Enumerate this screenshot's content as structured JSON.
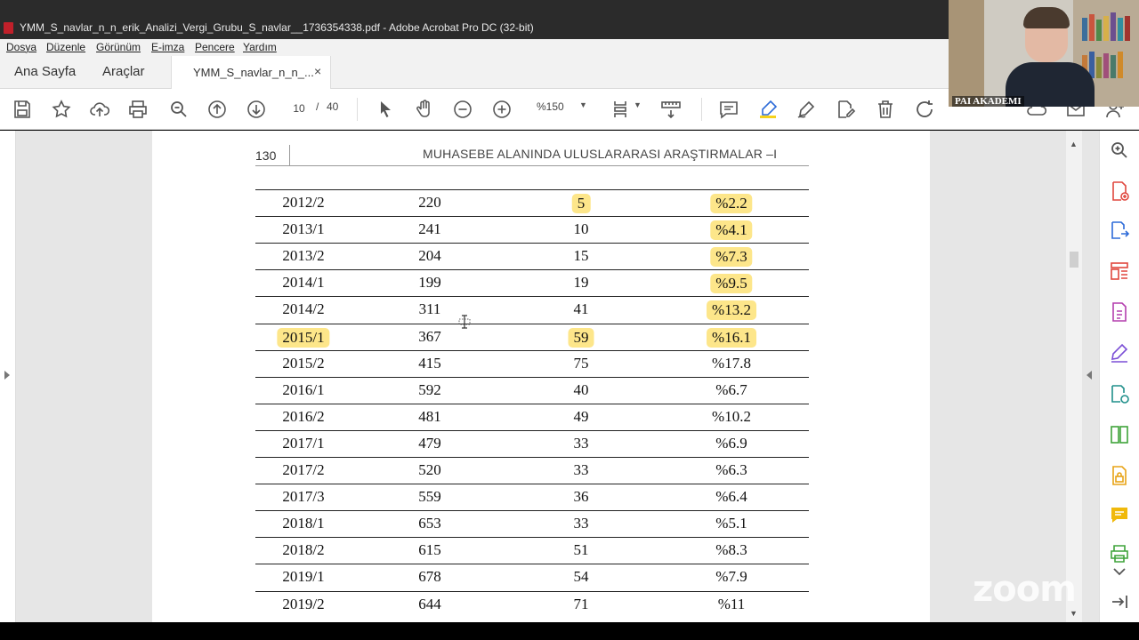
{
  "window": {
    "title": "YMM_S_navlar_n_n_erik_Analizi_Vergi_Grubu_S_navlar__1736354338.pdf - Adobe Acrobat Pro DC (32-bit)"
  },
  "menu": [
    "Dosya",
    "Düzenle",
    "Görünüm",
    "E-imza",
    "Pencere",
    "Yardım"
  ],
  "tabs": {
    "home": "Ana Sayfa",
    "tools": "Araçlar",
    "document": "YMM_S_navlar_n_n_...",
    "close": "×"
  },
  "toolbar": {
    "current_page": "10",
    "separator": "/",
    "total_pages": "40",
    "zoom": "%150",
    "icons": [
      "save-icon",
      "star-icon",
      "upload-icon",
      "print-icon",
      "search-icon",
      "page-up-icon",
      "page-down-icon",
      "select-cursor-icon",
      "hand-icon",
      "zoom-out-icon",
      "zoom-in-icon",
      "page-layout-icon",
      "measure-icon",
      "comment-icon",
      "highlight-icon",
      "draw-icon",
      "edit-icon",
      "delete-icon",
      "rotate-icon"
    ]
  },
  "page": {
    "number": "130",
    "running_head": "MUHASEBE ALANINDA ULUSLARARASI ARAŞTIRMALAR –I",
    "highlight_color": "#fde68a",
    "rows": [
      {
        "period": "2012/2",
        "a": "220",
        "b": "5",
        "pct": "%2.2",
        "hl": [
          false,
          false,
          true,
          true
        ]
      },
      {
        "period": "2013/1",
        "a": "241",
        "b": "10",
        "pct": "%4.1",
        "hl": [
          false,
          false,
          false,
          true
        ]
      },
      {
        "period": "2013/2",
        "a": "204",
        "b": "15",
        "pct": "%7.3",
        "hl": [
          false,
          false,
          false,
          true
        ]
      },
      {
        "period": "2014/1",
        "a": "199",
        "b": "19",
        "pct": "%9.5",
        "hl": [
          false,
          false,
          false,
          true
        ]
      },
      {
        "period": "2014/2",
        "a": "311",
        "b": "41",
        "pct": "%13.2",
        "hl": [
          false,
          false,
          false,
          true
        ]
      },
      {
        "period": "2015/1",
        "a": "367",
        "b": "59",
        "pct": "%16.1",
        "hl": [
          true,
          false,
          true,
          true
        ]
      },
      {
        "period": "2015/2",
        "a": "415",
        "b": "75",
        "pct": "%17.8",
        "hl": [
          false,
          false,
          false,
          false
        ]
      },
      {
        "period": "2016/1",
        "a": "592",
        "b": "40",
        "pct": "%6.7",
        "hl": [
          false,
          false,
          false,
          false
        ]
      },
      {
        "period": "2016/2",
        "a": "481",
        "b": "49",
        "pct": "%10.2",
        "hl": [
          false,
          false,
          false,
          false
        ]
      },
      {
        "period": "2017/1",
        "a": "479",
        "b": "33",
        "pct": "%6.9",
        "hl": [
          false,
          false,
          false,
          false
        ]
      },
      {
        "period": "2017/2",
        "a": "520",
        "b": "33",
        "pct": "%6.3",
        "hl": [
          false,
          false,
          false,
          false
        ]
      },
      {
        "period": "2017/3",
        "a": "559",
        "b": "36",
        "pct": "%6.4",
        "hl": [
          false,
          false,
          false,
          false
        ]
      },
      {
        "period": "2018/1",
        "a": "653",
        "b": "33",
        "pct": "%5.1",
        "hl": [
          false,
          false,
          false,
          false
        ]
      },
      {
        "period": "2018/2",
        "a": "615",
        "b": "51",
        "pct": "%8.3",
        "hl": [
          false,
          false,
          false,
          false
        ]
      },
      {
        "period": "2019/1",
        "a": "678",
        "b": "54",
        "pct": "%7.9",
        "hl": [
          false,
          false,
          false,
          false
        ]
      },
      {
        "period": "2019/2",
        "a": "644",
        "b": "71",
        "pct": "%11",
        "hl": [
          false,
          false,
          false,
          false
        ]
      }
    ]
  },
  "overlay": {
    "participant_name": "PAI AKADEMI",
    "watermark": "zoom"
  }
}
